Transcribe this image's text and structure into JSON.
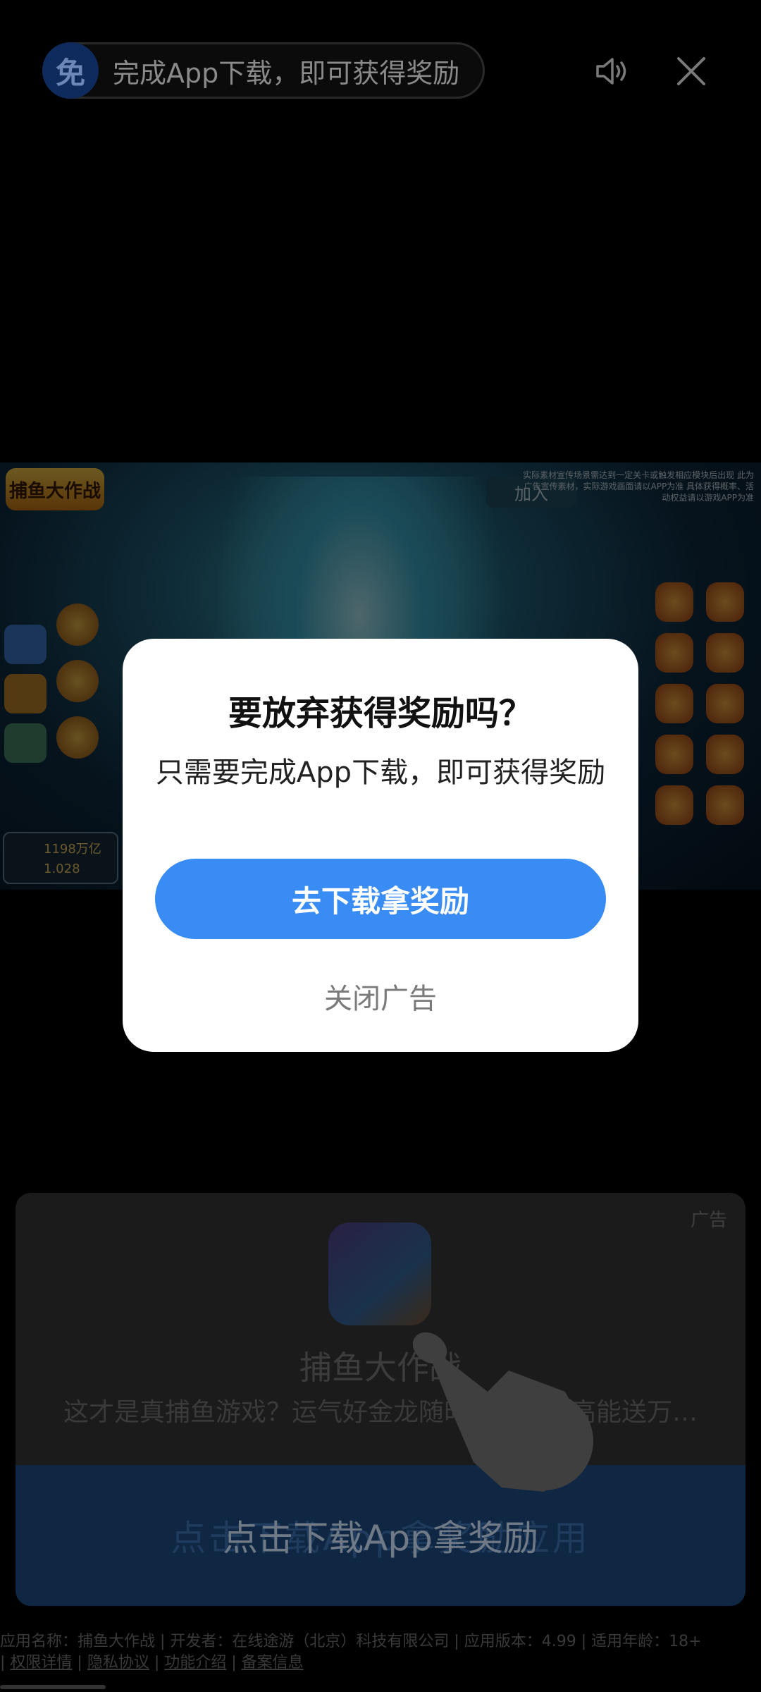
{
  "top_bar": {
    "badge": "免",
    "banner_text": "完成App下载，即可获得奖励",
    "sound_icon": "speaker-icon",
    "close_icon": "close-icon"
  },
  "game_banner": {
    "logo_text": "捕鱼大作战",
    "join_label": "加入",
    "notice": "实际素材宣传场景需达到一定关卡或触发相应模块后出现 此为广告宣传素材，实际游戏画面请以APP为准 具体获得概率、活动权益请以游戏APP为准",
    "coins": "1198万亿",
    "gems": "1.028"
  },
  "ad_card": {
    "ad_tag": "广告",
    "app_name": "捕鱼大作战",
    "app_desc": "这才是真捕鱼游戏？运气好金龙随时出现，最高能送万…",
    "cta_label": "点击下载App拿奖励",
    "cta_bg_text": "点击下载App拿奖励应用"
  },
  "footer": {
    "line1": "应用名称：捕鱼大作战 | 开发者：在线途游（北京）科技有限公司 | 应用版本：4.99 | 适用年龄：18+",
    "links": [
      "权限详情",
      "隐私协议",
      "功能介绍",
      "备案信息"
    ]
  },
  "dialog": {
    "title": "要放弃获得奖励吗？",
    "body": "只需要完成App下载，即可获得奖励",
    "primary_button": "去下载拿奖励",
    "secondary_button": "关闭广告"
  }
}
